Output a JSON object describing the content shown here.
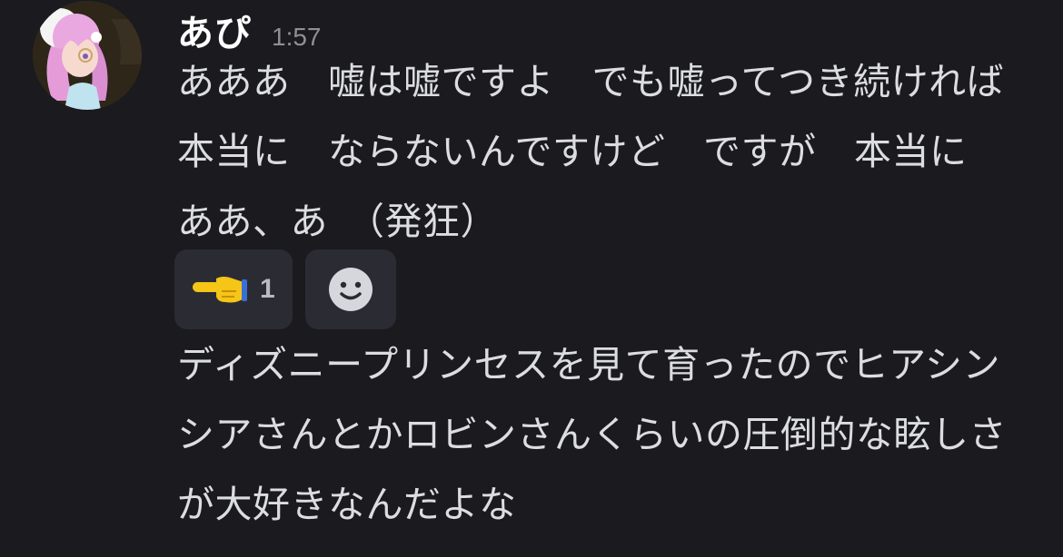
{
  "message": {
    "username": "あぴ",
    "timestamp": "1:57",
    "avatar_icon": "anime-character-avatar-icon",
    "text_1": "あああ　嘘は嘘ですよ　でも嘘ってつき続ければ本当に　ならないんですけど　ですが　本当に　ああ、あ　（発狂）",
    "text_2": "ディズニープリンセスを見て育ったのでヒアシンシアさんとかロビンさんくらいの圧倒的な眩しさが大好きなんだよな"
  },
  "reactions": [
    {
      "icon": "pointing-hand-left-icon",
      "count": "1"
    },
    {
      "icon": "add-reaction-smiley-icon"
    }
  ],
  "colors": {
    "background": "#1a1a1f",
    "text": "#dcdde1",
    "timestamp": "#8f9096",
    "reaction_bg": "#2b2c33",
    "emoji_yellow": "#f5c518"
  }
}
